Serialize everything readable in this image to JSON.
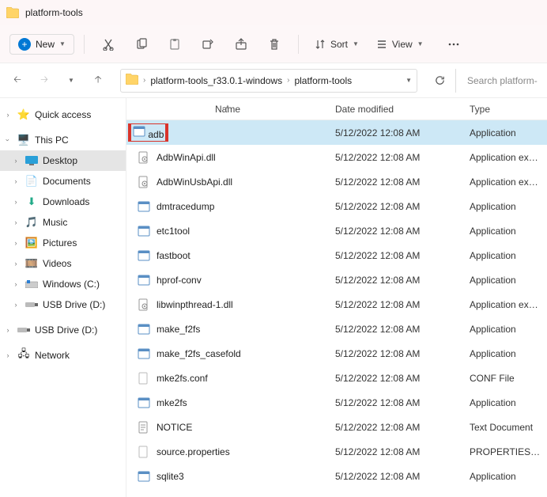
{
  "titlebar": {
    "title": "platform-tools"
  },
  "toolbar": {
    "new_label": "New",
    "sort_label": "Sort",
    "view_label": "View"
  },
  "breadcrumbs": {
    "items": [
      "platform-tools_r33.0.1-windows",
      "platform-tools"
    ]
  },
  "search": {
    "placeholder": "Search platform-"
  },
  "sidebar": {
    "quick_access": "Quick access",
    "this_pc": "This PC",
    "children": [
      {
        "label": "Desktop"
      },
      {
        "label": "Documents"
      },
      {
        "label": "Downloads"
      },
      {
        "label": "Music"
      },
      {
        "label": "Pictures"
      },
      {
        "label": "Videos"
      },
      {
        "label": "Windows (C:)"
      },
      {
        "label": "USB Drive (D:)"
      }
    ],
    "usb_drive": "USB Drive (D:)",
    "network": "Network"
  },
  "columns": {
    "name": "Name",
    "date": "Date modified",
    "type": "Type"
  },
  "files": [
    {
      "name": "adb",
      "date": "5/12/2022 12:08 AM",
      "type": "Application",
      "icon": "exe",
      "selected": true,
      "highlight": true
    },
    {
      "name": "AdbWinApi.dll",
      "date": "5/12/2022 12:08 AM",
      "type": "Application exten...",
      "icon": "dll"
    },
    {
      "name": "AdbWinUsbApi.dll",
      "date": "5/12/2022 12:08 AM",
      "type": "Application exten...",
      "icon": "dll"
    },
    {
      "name": "dmtracedump",
      "date": "5/12/2022 12:08 AM",
      "type": "Application",
      "icon": "exe"
    },
    {
      "name": "etc1tool",
      "date": "5/12/2022 12:08 AM",
      "type": "Application",
      "icon": "exe"
    },
    {
      "name": "fastboot",
      "date": "5/12/2022 12:08 AM",
      "type": "Application",
      "icon": "exe"
    },
    {
      "name": "hprof-conv",
      "date": "5/12/2022 12:08 AM",
      "type": "Application",
      "icon": "exe"
    },
    {
      "name": "libwinpthread-1.dll",
      "date": "5/12/2022 12:08 AM",
      "type": "Application exten...",
      "icon": "dll"
    },
    {
      "name": "make_f2fs",
      "date": "5/12/2022 12:08 AM",
      "type": "Application",
      "icon": "exe"
    },
    {
      "name": "make_f2fs_casefold",
      "date": "5/12/2022 12:08 AM",
      "type": "Application",
      "icon": "exe"
    },
    {
      "name": "mke2fs.conf",
      "date": "5/12/2022 12:08 AM",
      "type": "CONF File",
      "icon": "file"
    },
    {
      "name": "mke2fs",
      "date": "5/12/2022 12:08 AM",
      "type": "Application",
      "icon": "exe"
    },
    {
      "name": "NOTICE",
      "date": "5/12/2022 12:08 AM",
      "type": "Text Document",
      "icon": "txt"
    },
    {
      "name": "source.properties",
      "date": "5/12/2022 12:08 AM",
      "type": "PROPERTIES File",
      "icon": "file"
    },
    {
      "name": "sqlite3",
      "date": "5/12/2022 12:08 AM",
      "type": "Application",
      "icon": "exe"
    }
  ]
}
